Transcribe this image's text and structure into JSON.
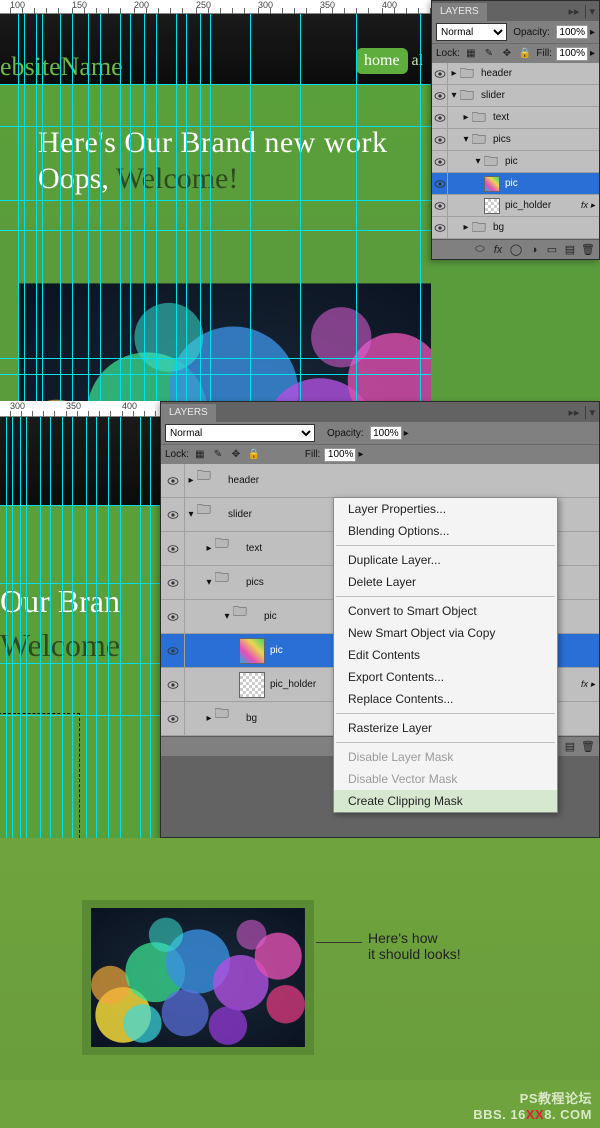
{
  "sec1": {
    "ruler_marks": [
      "100",
      "150",
      "200",
      "250",
      "300",
      "350",
      "400"
    ],
    "site_name": "ebsiteName",
    "nav_home": "home",
    "nav_other": "al",
    "hero_line1": "Here's Our Brand new work",
    "hero_line2a": "Oops, ",
    "hero_line2b": "Welcome!"
  },
  "layers_small": {
    "tab": "LAYERS",
    "blend_mode": "Normal",
    "opacity_label": "Opacity:",
    "opacity_val": "100%",
    "lock_label": "Lock:",
    "fill_label": "Fill:",
    "fill_val": "100%",
    "rows": [
      {
        "name": "header",
        "type": "folder",
        "indent": 0,
        "expand": "▸"
      },
      {
        "name": "slider",
        "type": "folder",
        "indent": 0,
        "expand": "▾"
      },
      {
        "name": "text",
        "type": "folder",
        "indent": 1,
        "expand": "▸"
      },
      {
        "name": "pics",
        "type": "folder",
        "indent": 1,
        "expand": "▾"
      },
      {
        "name": "pic",
        "type": "folder",
        "indent": 2,
        "expand": "▾"
      },
      {
        "name": "pic",
        "type": "layer",
        "indent": 3,
        "thumb": "bokeh",
        "sel": true
      },
      {
        "name": "pic_holder",
        "type": "layer",
        "indent": 3,
        "thumb": "checker",
        "fx": "fx ▸"
      },
      {
        "name": "bg",
        "type": "folder",
        "indent": 1,
        "expand": "▸"
      }
    ]
  },
  "sec2": {
    "ruler_marks": [
      "300",
      "350",
      "400"
    ],
    "h1": "Our Bran",
    "h2": "Welcome"
  },
  "layers_big": {
    "tab": "LAYERS",
    "blend_mode": "Normal",
    "opacity_label": "Opacity:",
    "opacity_val": "100%",
    "lock_label": "Lock:",
    "fill_label": "Fill:",
    "fill_val": "100%",
    "rows": [
      {
        "name": "header",
        "type": "folder",
        "indent": 0,
        "expand": "▸"
      },
      {
        "name": "slider",
        "type": "folder",
        "indent": 0,
        "expand": "▾"
      },
      {
        "name": "text",
        "type": "folder",
        "indent": 1,
        "expand": "▸"
      },
      {
        "name": "pics",
        "type": "folder",
        "indent": 1,
        "expand": "▾"
      },
      {
        "name": "pic",
        "type": "folder",
        "indent": 2,
        "expand": "▾"
      },
      {
        "name": "pic",
        "type": "layer",
        "indent": 3,
        "thumb": "bokeh",
        "sel": true
      },
      {
        "name": "pic_holder",
        "type": "layer",
        "indent": 3,
        "thumb": "checker",
        "fx": "fx ▸"
      },
      {
        "name": "bg",
        "type": "folder",
        "indent": 1,
        "expand": "▸"
      }
    ]
  },
  "ctx": {
    "items": [
      {
        "t": "Layer Properties..."
      },
      {
        "t": "Blending Options..."
      },
      {
        "sep": true
      },
      {
        "t": "Duplicate Layer..."
      },
      {
        "t": "Delete Layer"
      },
      {
        "sep": true
      },
      {
        "t": "Convert to Smart Object"
      },
      {
        "t": "New Smart Object via Copy"
      },
      {
        "t": "Edit Contents"
      },
      {
        "t": "Export Contents..."
      },
      {
        "t": "Replace Contents..."
      },
      {
        "sep": true
      },
      {
        "t": "Rasterize Layer"
      },
      {
        "sep": true
      },
      {
        "t": "Disable Layer Mask",
        "dis": true
      },
      {
        "t": "Disable Vector Mask",
        "dis": true
      },
      {
        "t": "Create Clipping Mask",
        "hl": true
      }
    ]
  },
  "sec3": {
    "callout1": "Here's how",
    "callout2": "it should looks!",
    "watermark1": "PS教程论坛",
    "watermark2a": "BBS. 16",
    "watermark2b": "XX",
    "watermark2c": "8. COM"
  }
}
